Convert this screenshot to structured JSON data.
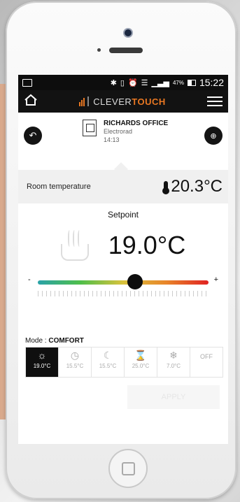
{
  "status_bar": {
    "battery": "47%",
    "time": "15:22",
    "icons": [
      "bluetooth-icon",
      "vibrate-icon",
      "alarm-icon",
      "wifi-icon",
      "signal-icon",
      "battery-icon"
    ]
  },
  "app": {
    "brand_prefix": "CLEVER",
    "brand_suffix": "TOUCH",
    "brand_color": "#e87722"
  },
  "device": {
    "name": "RICHARDS OFFICE",
    "type": "Electrorad",
    "time": "14:13"
  },
  "room": {
    "label": "Room temperature",
    "value": "20.3°C"
  },
  "setpoint": {
    "label": "Setpoint",
    "value": "19.0°C",
    "slider_fraction": 0.57,
    "minus": "-",
    "plus": "+"
  },
  "mode": {
    "label": "Mode : ",
    "current": "COMFORT",
    "options": [
      {
        "icon": "☼",
        "temp": "19.0°C",
        "name": "comfort",
        "active": true
      },
      {
        "icon": "◷",
        "temp": "15.5°C",
        "name": "eco"
      },
      {
        "icon": "☾",
        "temp": "15.5°C",
        "name": "night"
      },
      {
        "icon": "⌛",
        "temp": "25.0°C",
        "name": "boost"
      },
      {
        "icon": "❄",
        "temp": "7.0°C",
        "name": "frost"
      },
      {
        "icon": "OFF",
        "temp": "",
        "name": "off"
      }
    ],
    "apply": "APPLY"
  }
}
